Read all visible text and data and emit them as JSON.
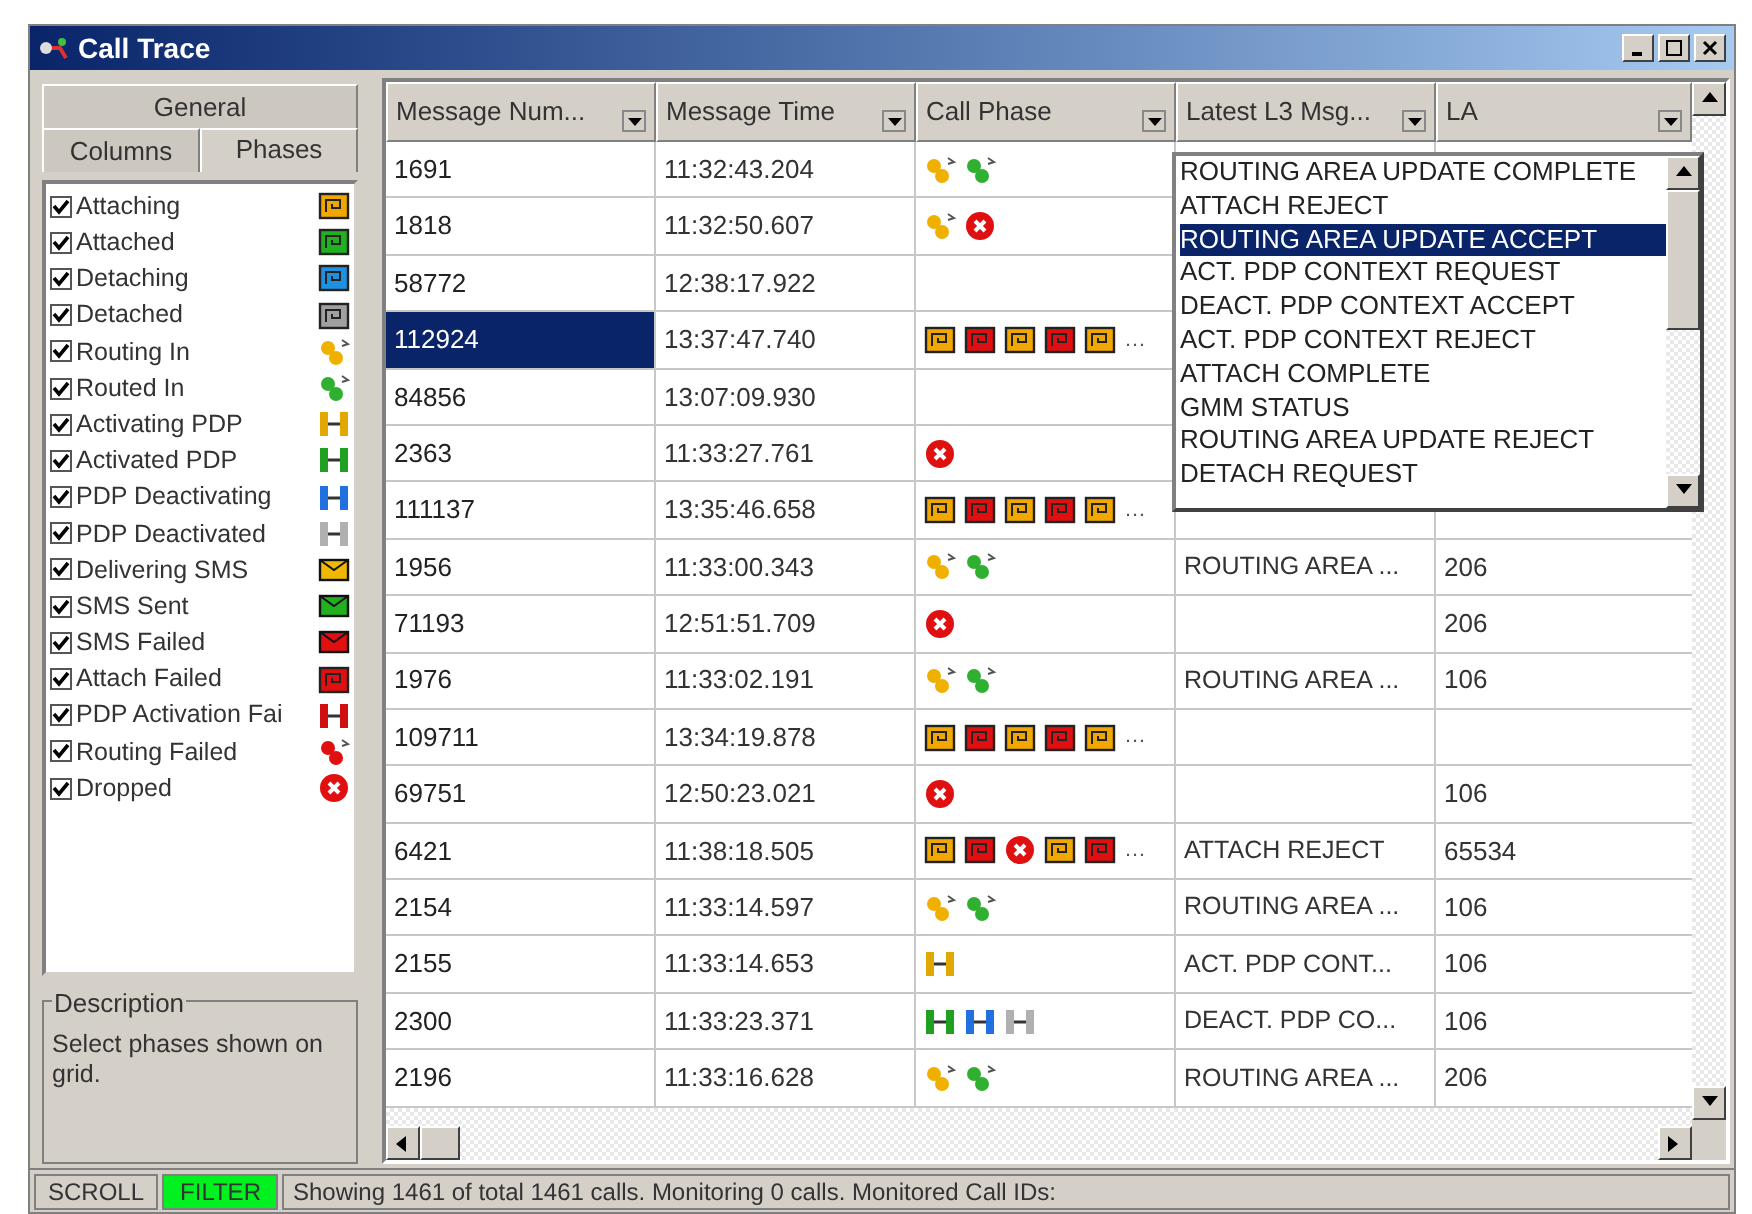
{
  "window": {
    "title": "Call Trace"
  },
  "tabs": [
    {
      "label": "General",
      "selected": false
    },
    {
      "label": "Columns",
      "selected": false
    },
    {
      "label": "Phases",
      "selected": true
    }
  ],
  "phases": [
    {
      "label": "Attaching",
      "checked": true,
      "kind": "attaching"
    },
    {
      "label": "Attached",
      "checked": true,
      "kind": "attached"
    },
    {
      "label": "Detaching",
      "checked": true,
      "kind": "detaching"
    },
    {
      "label": "Detached",
      "checked": true,
      "kind": "detached"
    },
    {
      "label": "Routing In",
      "checked": true,
      "kind": "routing_in"
    },
    {
      "label": "Routed In",
      "checked": true,
      "kind": "routed_in"
    },
    {
      "label": "Activating PDP",
      "checked": true,
      "kind": "activating_pdp"
    },
    {
      "label": "Activated PDP",
      "checked": true,
      "kind": "activated_pdp"
    },
    {
      "label": "PDP Deactivating",
      "checked": true,
      "kind": "pdp_deactivating"
    },
    {
      "label": "PDP Deactivated",
      "checked": true,
      "kind": "pdp_deactivated"
    },
    {
      "label": "Delivering SMS",
      "checked": true,
      "kind": "delivering_sms"
    },
    {
      "label": "SMS Sent",
      "checked": true,
      "kind": "sms_sent"
    },
    {
      "label": "SMS Failed",
      "checked": true,
      "kind": "sms_failed"
    },
    {
      "label": "Attach Failed",
      "checked": true,
      "kind": "attach_failed"
    },
    {
      "label": "PDP Activation Fai",
      "checked": true,
      "kind": "pdp_activation_failed"
    },
    {
      "label": "Routing Failed",
      "checked": true,
      "kind": "routing_failed"
    },
    {
      "label": "Dropped",
      "checked": true,
      "kind": "dropped"
    }
  ],
  "description": {
    "title": "Description",
    "text": "Select phases shown on grid."
  },
  "table": {
    "columns": [
      "Message Num...",
      "Message Time",
      "Call Phase",
      "Latest L3 Msg...",
      "LA"
    ],
    "rows": [
      {
        "number": "1691",
        "time": "11:32:43.204",
        "phases": [
          {
            "kind": "routing_in"
          },
          {
            "kind": "routed_in"
          }
        ],
        "selected": false
      },
      {
        "number": "1818",
        "time": "11:32:50.607",
        "phases": [
          {
            "kind": "routing_in"
          },
          {
            "kind": "dropped"
          }
        ],
        "selected": false
      },
      {
        "number": "58772",
        "time": "12:38:17.922",
        "phases": [],
        "selected": false
      },
      {
        "number": "112924",
        "time": "13:37:47.740",
        "phases": [
          {
            "kind": "attaching"
          },
          {
            "kind": "attach_failed"
          },
          {
            "kind": "attaching"
          },
          {
            "kind": "attach_failed"
          },
          {
            "kind": "attaching"
          }
        ],
        "more": "…",
        "selected": true
      },
      {
        "number": "84856",
        "time": "13:07:09.930",
        "phases": [],
        "selected": false
      },
      {
        "number": "2363",
        "time": "11:33:27.761",
        "phases": [
          {
            "kind": "dropped"
          }
        ],
        "selected": false
      },
      {
        "number": "111137",
        "time": "13:35:46.658",
        "phases": [
          {
            "kind": "attaching"
          },
          {
            "kind": "attach_failed"
          },
          {
            "kind": "attaching"
          },
          {
            "kind": "attach_failed"
          },
          {
            "kind": "attaching"
          }
        ],
        "more": "…",
        "selected": false
      },
      {
        "number": "1956",
        "time": "11:33:00.343",
        "phases": [
          {
            "kind": "routing_in"
          },
          {
            "kind": "routed_in"
          }
        ],
        "l3": "ROUTING AREA ...",
        "la": "206",
        "selected": false
      },
      {
        "number": "71193",
        "time": "12:51:51.709",
        "phases": [
          {
            "kind": "dropped"
          }
        ],
        "la": "206",
        "selected": false
      },
      {
        "number": "1976",
        "time": "11:33:02.191",
        "phases": [
          {
            "kind": "routing_in"
          },
          {
            "kind": "routed_in"
          }
        ],
        "l3": "ROUTING AREA ...",
        "la": "106",
        "selected": false
      },
      {
        "number": "109711",
        "time": "13:34:19.878",
        "phases": [
          {
            "kind": "attaching"
          },
          {
            "kind": "attach_failed"
          },
          {
            "kind": "attaching"
          },
          {
            "kind": "attach_failed"
          },
          {
            "kind": "attaching"
          }
        ],
        "more": "…",
        "selected": false
      },
      {
        "number": "69751",
        "time": "12:50:23.021",
        "phases": [
          {
            "kind": "dropped"
          }
        ],
        "la": "106",
        "selected": false
      },
      {
        "number": "6421",
        "time": "11:38:18.505",
        "phases": [
          {
            "kind": "attaching"
          },
          {
            "kind": "attach_failed"
          },
          {
            "kind": "dropped"
          },
          {
            "kind": "attaching"
          },
          {
            "kind": "attach_failed"
          }
        ],
        "more": "…",
        "l3": "ATTACH REJECT",
        "la": "65534",
        "selected": false
      },
      {
        "number": "2154",
        "time": "11:33:14.597",
        "phases": [
          {
            "kind": "routing_in"
          },
          {
            "kind": "routed_in"
          }
        ],
        "l3": "ROUTING AREA ...",
        "la": "106",
        "selected": false
      },
      {
        "number": "2155",
        "time": "11:33:14.653",
        "phases": [
          {
            "kind": "activating_pdp"
          }
        ],
        "l3": "ACT. PDP CONT...",
        "la": "106",
        "selected": false
      },
      {
        "number": "2300",
        "time": "11:33:23.371",
        "phases": [
          {
            "kind": "activated_pdp"
          },
          {
            "kind": "pdp_deactivating"
          },
          {
            "kind": "pdp_deactivated"
          }
        ],
        "l3": "DEACT. PDP CO...",
        "la": "106",
        "selected": false
      },
      {
        "number": "2196",
        "time": "11:33:16.628",
        "phases": [
          {
            "kind": "routing_in"
          },
          {
            "kind": "routed_in"
          }
        ],
        "l3": "ROUTING AREA ...",
        "la": "206",
        "selected": false
      }
    ]
  },
  "filter_list": [
    {
      "label": "ROUTING AREA UPDATE COMPLETE",
      "selected": false
    },
    {
      "label": "ATTACH REJECT",
      "selected": false
    },
    {
      "label": "ROUTING AREA UPDATE ACCEPT",
      "selected": true
    },
    {
      "label": "ACT. PDP CONTEXT REQUEST",
      "selected": false
    },
    {
      "label": "DEACT. PDP CONTEXT ACCEPT",
      "selected": false
    },
    {
      "label": "ACT. PDP CONTEXT REJECT",
      "selected": false
    },
    {
      "label": "ATTACH COMPLETE",
      "selected": false
    },
    {
      "label": "GMM STATUS",
      "selected": false
    },
    {
      "label": "ROUTING AREA UPDATE REJECT",
      "selected": false
    },
    {
      "label": "DETACH REQUEST",
      "selected": false
    }
  ],
  "status_bar": {
    "scroll": "SCROLL",
    "filter": "FILTER",
    "filter_on": true,
    "message": "Showing 1461 of total 1461 calls. Monitoring 0 calls. Monitored Call IDs:"
  }
}
